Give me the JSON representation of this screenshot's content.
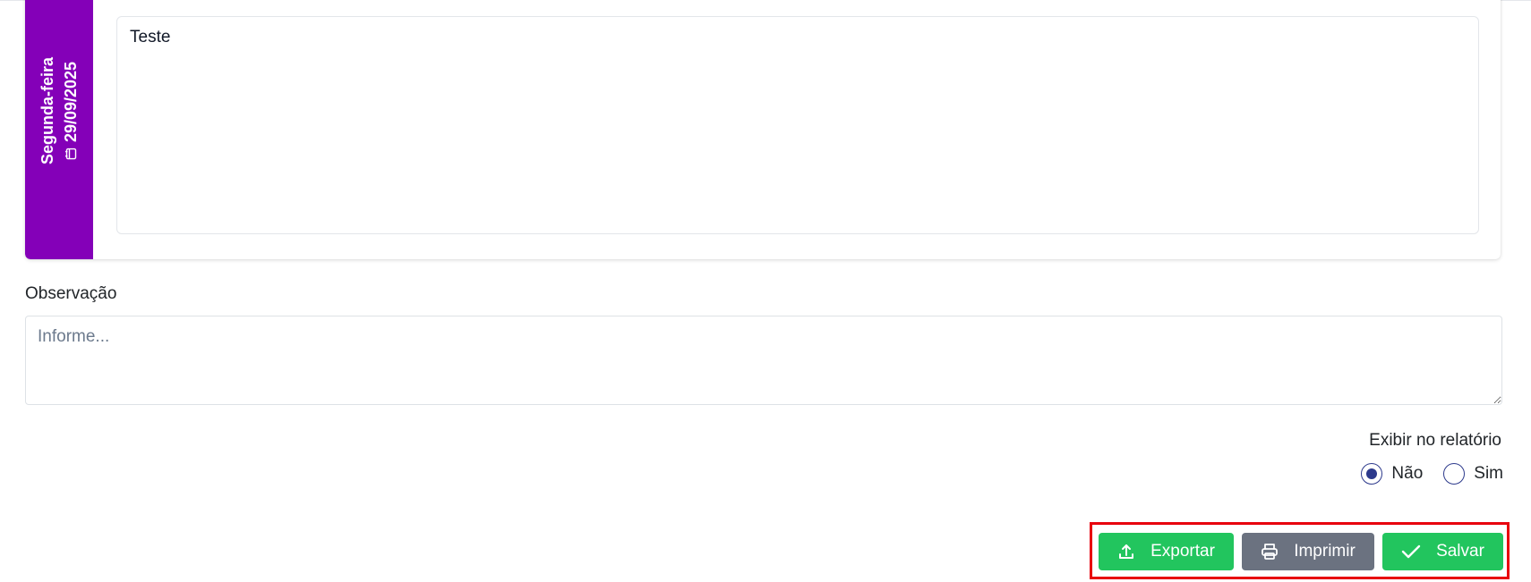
{
  "day_card": {
    "weekday": "Segunda-feira",
    "date": "29/09/2025",
    "content_text": "Teste",
    "accent_color": "#8400b8"
  },
  "observation": {
    "label": "Observação",
    "placeholder": "Informe..."
  },
  "report": {
    "label": "Exibir no relatório",
    "options": [
      {
        "label": "Não",
        "selected": true
      },
      {
        "label": "Sim",
        "selected": false
      }
    ]
  },
  "actions": {
    "export_label": "Exportar",
    "print_label": "Imprimir",
    "save_label": "Salvar",
    "export_icon": "upload-icon",
    "print_icon": "printer-icon",
    "save_icon": "check-icon",
    "green": "#22c55e",
    "gray": "#6b7280",
    "highlight": "#e8000d"
  }
}
